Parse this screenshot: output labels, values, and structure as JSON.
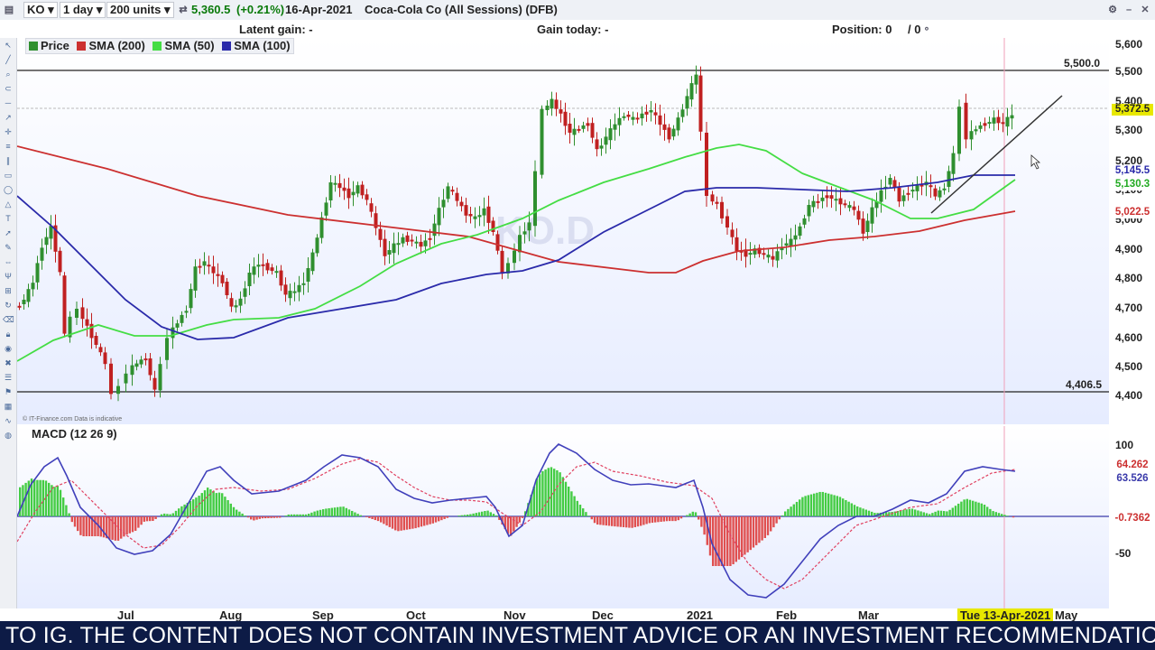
{
  "toolbar": {
    "symbol": "KO",
    "interval": "1 day",
    "units": "200 units",
    "quote_price": "5,360.5",
    "quote_change": "(+0.21%)",
    "date": "16-Apr-2021",
    "instrument": "Coca-Cola Co (All Sessions) (DFB)"
  },
  "info": {
    "latent_gain": "Latent gain: -",
    "gain_today": "Gain today: -",
    "position": "Position: 0",
    "position_sep": "/ 0"
  },
  "legend": {
    "price": "Price",
    "sma200": "SMA (200)",
    "sma50": "SMA (50)",
    "sma100": "SMA (100)"
  },
  "watermark": "KO.D",
  "source_note": "© IT-Finance.com  Data is indicative",
  "price_axis": {
    "ticks": [
      "5,600",
      "5,500",
      "5,400",
      "5,300",
      "5,200",
      "5,100",
      "5,000",
      "4,900",
      "4,800",
      "4,700",
      "4,600",
      "4,500",
      "4,400"
    ],
    "current_price_tag": "5,372.5",
    "sma100_tag": "5,145.5",
    "sma50_tag": "5,130.3",
    "sma200_tag": "5,022.5"
  },
  "lines": {
    "upper_level": "5,500.0",
    "lower_level": "4,406.5"
  },
  "macd": {
    "label": "MACD (12 26 9)",
    "ticks": [
      "100",
      "-50"
    ],
    "macd_tag": "64.262",
    "signal_tag": "63.526",
    "hist_tag": "-0.7362"
  },
  "x_axis": {
    "labels": [
      "Jul",
      "Aug",
      "Sep",
      "Oct",
      "Nov",
      "Dec",
      "2021",
      "Feb",
      "Mar",
      "Apr",
      "May"
    ],
    "crosshair_date": "Tue 13-Apr-2021"
  },
  "ticker_text": "TO IG. THE CONTENT DOES NOT CONTAIN INVESTMENT ADVICE OR AN INVESTMENT RECOMMENDATION",
  "colors": {
    "sma200": "#cc3030",
    "sma50": "#44dd44",
    "sma100": "#2a2aaa",
    "up_candle": "#2f8f2f",
    "down_candle": "#c02020",
    "ticker_bg": "#0d1b46",
    "price_tag": "#e8e800"
  }
}
